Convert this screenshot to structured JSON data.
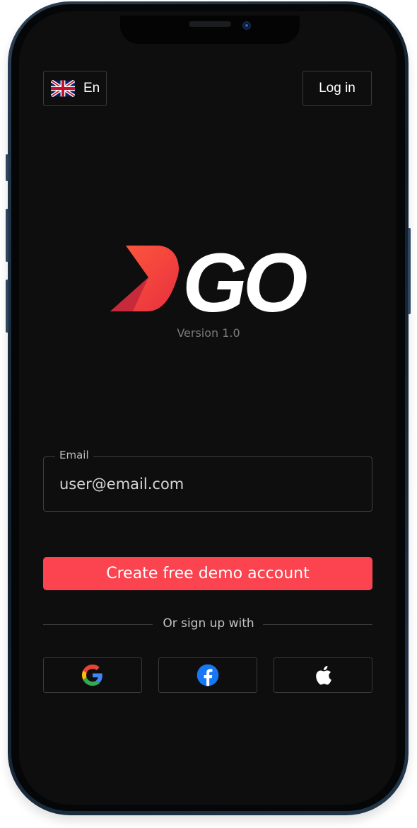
{
  "header": {
    "language_label": "En",
    "login_label": "Log in"
  },
  "brand": {
    "logo_text": "GO",
    "version": "Version 1.0",
    "accent_color": "#fb4450"
  },
  "signup_form": {
    "email_label": "Email",
    "email_value": "user@email.com",
    "submit_label": "Create free demo account"
  },
  "social": {
    "divider_text": "Or sign up with",
    "providers": [
      {
        "name": "google",
        "icon": "google-icon"
      },
      {
        "name": "facebook",
        "icon": "facebook-icon"
      },
      {
        "name": "apple",
        "icon": "apple-icon"
      }
    ]
  }
}
